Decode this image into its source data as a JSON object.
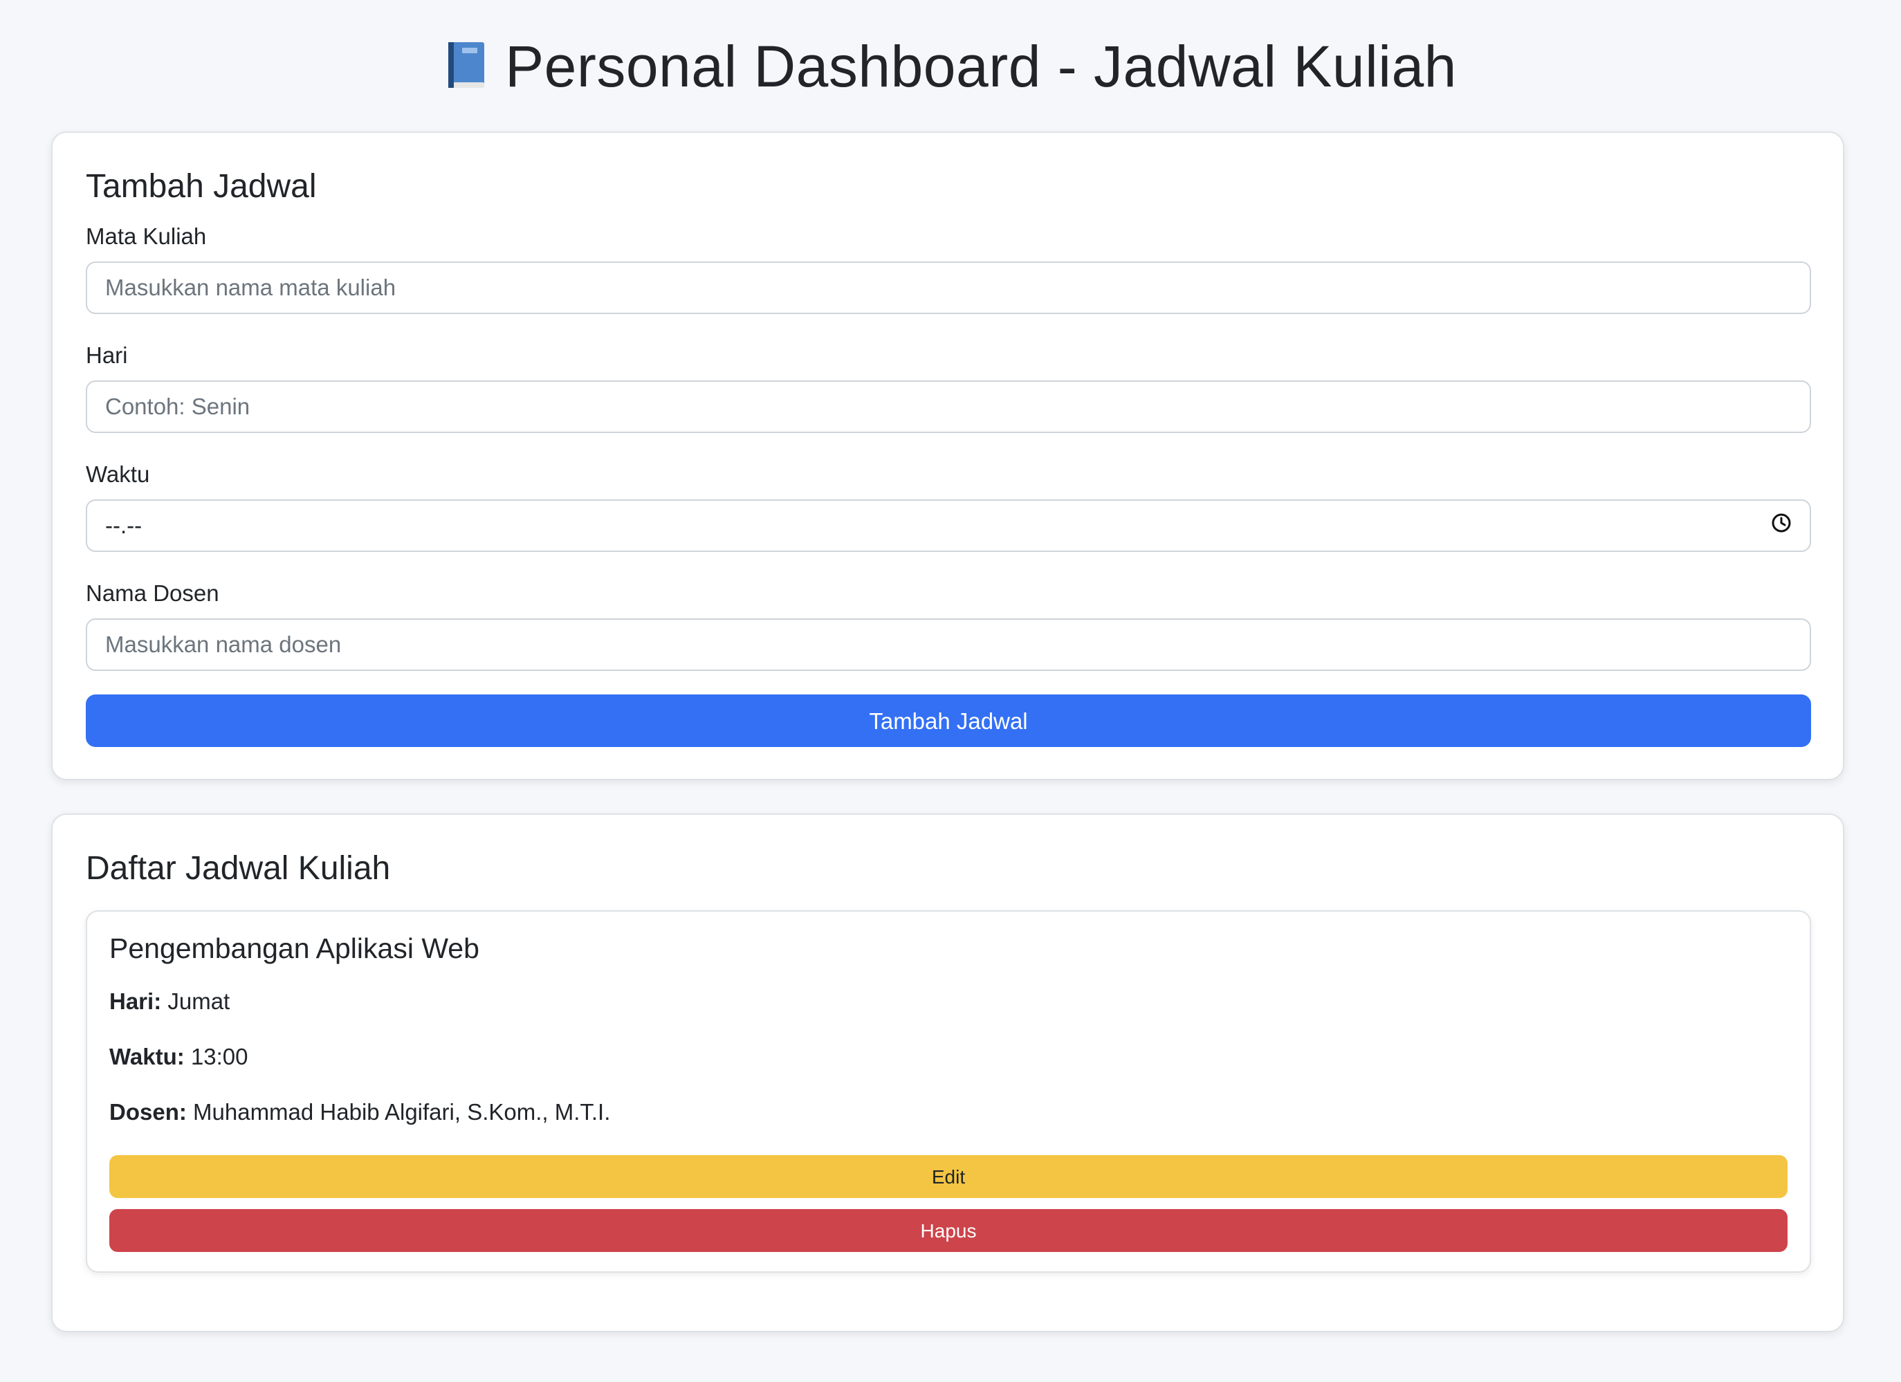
{
  "header": {
    "icon": "blue-book-icon",
    "title": "Personal Dashboard - Jadwal Kuliah"
  },
  "form": {
    "heading": "Tambah Jadwal",
    "course_label": "Mata Kuliah",
    "course_placeholder": "Masukkan nama mata kuliah",
    "day_label": "Hari",
    "day_placeholder": "Contoh: Senin",
    "time_label": "Waktu",
    "time_value": "--.--",
    "time_icon": "clock-icon",
    "lecturer_label": "Nama Dosen",
    "lecturer_placeholder": "Masukkan nama dosen",
    "submit_label": "Tambah Jadwal"
  },
  "list": {
    "heading": "Daftar Jadwal Kuliah",
    "items": [
      {
        "course": "Pengembangan Aplikasi Web",
        "day_label": "Hari:",
        "day": "Jumat",
        "time_label": "Waktu:",
        "time": "13:00",
        "lecturer_label": "Dosen:",
        "lecturer": "Muhammad Habib Algifari, S.Kom., M.T.I.",
        "edit_label": "Edit",
        "delete_label": "Hapus"
      }
    ]
  },
  "colors": {
    "primary": "#3370f4",
    "edit": "#f4c542",
    "delete": "#cd444a",
    "background": "#f5f7fa"
  }
}
